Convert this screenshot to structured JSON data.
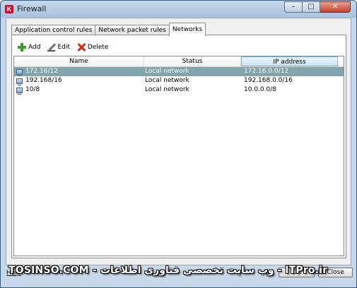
{
  "window": {
    "title": "Firewall",
    "buttons": {
      "minimize": "–",
      "maximize": "□",
      "close": "✕"
    }
  },
  "tabs": [
    {
      "label": "Application control rules",
      "active": false
    },
    {
      "label": "Network packet rules",
      "active": false
    },
    {
      "label": "Networks",
      "active": true
    }
  ],
  "toolbar": {
    "add_label": "Add",
    "edit_label": "Edit",
    "delete_label": "Delete"
  },
  "table": {
    "columns": [
      "Name",
      "Status",
      "IP address"
    ],
    "rows": [
      {
        "name": "172.16/12",
        "status": "Local network",
        "ip": "172.16.0.0/12",
        "selected": true
      },
      {
        "name": "192.168/16",
        "status": "Local network",
        "ip": "192.168.0.0/16",
        "selected": false
      },
      {
        "name": "10/8",
        "status": "Local network",
        "ip": "10.0.0.0/8",
        "selected": false
      }
    ]
  },
  "footer": {
    "help_label": "Help",
    "ok_label": "OK",
    "close_label": "Close"
  },
  "watermark": "TOSINSO.COM - وب سایت تخصصی فناوری اطلاعات - ITPro.ir",
  "colors": {
    "selection": "#7fa6ad",
    "titlebar": "#b7cde6",
    "sort_column": "#cfe6f8"
  },
  "icons": {
    "app": "kaspersky-logo-icon",
    "network": "network-monitor-icon"
  }
}
